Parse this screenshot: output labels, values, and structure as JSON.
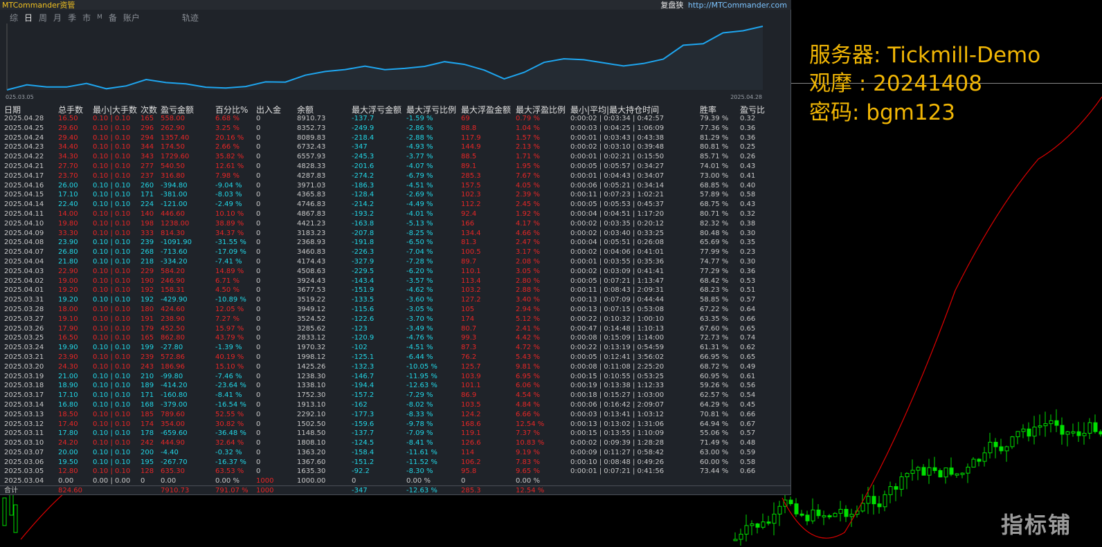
{
  "window": {
    "title": "MTCommander资管",
    "replay_label": "复盘狭",
    "site": "http://MTCommander.com"
  },
  "tabs": [
    "综",
    "日",
    "周",
    "月",
    "季",
    "市",
    "M",
    "备",
    "账户",
    "轨迹"
  ],
  "active_tab": "日",
  "equity": {
    "start_date": "025.03.05",
    "end_date": "2025.04.28",
    "line_color": "#1ea6f0"
  },
  "columns": [
    "日期",
    "总手数",
    "最小|大手数",
    "次数",
    "盈亏金额",
    "百分比%",
    "出入金",
    "余额",
    "最大浮亏金额",
    "最大浮亏比例",
    "最大浮盈金额",
    "最大浮盈比例",
    "最小|平均|最大持仓时间",
    "胜率",
    "盈亏比"
  ],
  "rows": [
    {
      "d": "2025.04.28",
      "lots": "16.50",
      "mm": "0.10 | 0.10",
      "n": "165",
      "pl": "558.00",
      "pct": "6.68 %",
      "io": "0",
      "bal": "8910.73",
      "mfl": "-137.7",
      "mflp": "-1.59 %",
      "mfp": "69",
      "mfpp": "0.79 %",
      "hold": "0:00:02 | 0:03:34 | 0:42:57",
      "win": "79.39 %",
      "ratio": "0.32",
      "s": "red"
    },
    {
      "d": "2025.04.25",
      "lots": "29.60",
      "mm": "0.10 | 0.10",
      "n": "296",
      "pl": "262.90",
      "pct": "3.25 %",
      "io": "0",
      "bal": "8352.73",
      "mfl": "-249.9",
      "mflp": "-2.86 %",
      "mfp": "88.8",
      "mfpp": "1.04 %",
      "hold": "0:00:03 | 0:04:25 | 1:06:09",
      "win": "77.36 %",
      "ratio": "0.36",
      "s": "red"
    },
    {
      "d": "2025.04.24",
      "lots": "29.40",
      "mm": "0.10 | 0.10",
      "n": "294",
      "pl": "1357.40",
      "pct": "20.16 %",
      "io": "0",
      "bal": "8089.83",
      "mfl": "-218.4",
      "mflp": "-2.88 %",
      "mfp": "117.9",
      "mfpp": "1.57 %",
      "hold": "0:00:01 | 0:03:43 | 0:43:38",
      "win": "81.29 %",
      "ratio": "0.36",
      "s": "red"
    },
    {
      "d": "2025.04.23",
      "lots": "34.40",
      "mm": "0.10 | 0.10",
      "n": "344",
      "pl": "174.50",
      "pct": "2.66 %",
      "io": "0",
      "bal": "6732.43",
      "mfl": "-347",
      "mflp": "-4.93 %",
      "mfp": "144.9",
      "mfpp": "2.13 %",
      "hold": "0:00:02 | 0:03:10 | 0:39:48",
      "win": "80.81 %",
      "ratio": "0.25",
      "s": "red"
    },
    {
      "d": "2025.04.22",
      "lots": "34.30",
      "mm": "0.10 | 0.10",
      "n": "343",
      "pl": "1729.60",
      "pct": "35.82 %",
      "io": "0",
      "bal": "6557.93",
      "mfl": "-245.3",
      "mflp": "-3.77 %",
      "mfp": "88.5",
      "mfpp": "1.71 %",
      "hold": "0:00:01 | 0:02:21 | 0:15:50",
      "win": "85.71 %",
      "ratio": "0.26",
      "s": "red"
    },
    {
      "d": "2025.04.21",
      "lots": "27.70",
      "mm": "0.10 | 0.10",
      "n": "277",
      "pl": "540.50",
      "pct": "12.61 %",
      "io": "0",
      "bal": "4828.33",
      "mfl": "-201.6",
      "mflp": "-4.07 %",
      "mfp": "89.1",
      "mfpp": "1.95 %",
      "hold": "0:00:05 | 0:05:57 | 0:34:27",
      "win": "74.01 %",
      "ratio": "0.43",
      "s": "red"
    },
    {
      "d": "2025.04.17",
      "lots": "23.70",
      "mm": "0.10 | 0.10",
      "n": "237",
      "pl": "316.80",
      "pct": "7.98 %",
      "io": "0",
      "bal": "4287.83",
      "mfl": "-274.2",
      "mflp": "-6.79 %",
      "mfp": "285.3",
      "mfpp": "7.67 %",
      "hold": "0:00:01 | 0:04:43 | 0:34:07",
      "win": "73.00 %",
      "ratio": "0.41",
      "s": "red"
    },
    {
      "d": "2025.04.16",
      "lots": "26.00",
      "mm": "0.10 | 0.10",
      "n": "260",
      "pl": "-394.80",
      "pct": "-9.04 %",
      "io": "0",
      "bal": "3971.03",
      "mfl": "-186.3",
      "mflp": "-4.51 %",
      "mfp": "157.5",
      "mfpp": "4.05 %",
      "hold": "0:00:06 | 0:05:21 | 0:34:14",
      "win": "68.85 %",
      "ratio": "0.40",
      "s": "cyan"
    },
    {
      "d": "2025.04.15",
      "lots": "17.10",
      "mm": "0.10 | 0.10",
      "n": "171",
      "pl": "-381.00",
      "pct": "-8.03 %",
      "io": "0",
      "bal": "4365.83",
      "mfl": "-128.4",
      "mflp": "-2.69 %",
      "mfp": "102.3",
      "mfpp": "2.39 %",
      "hold": "0:00:11 | 0:07:23 | 1:02:21",
      "win": "57.89 %",
      "ratio": "0.58",
      "s": "cyan"
    },
    {
      "d": "2025.04.14",
      "lots": "22.40",
      "mm": "0.10 | 0.10",
      "n": "224",
      "pl": "-121.00",
      "pct": "-2.49 %",
      "io": "0",
      "bal": "4746.83",
      "mfl": "-214.2",
      "mflp": "-4.49 %",
      "mfp": "112.2",
      "mfpp": "2.45 %",
      "hold": "0:00:05 | 0:05:53 | 0:45:37",
      "win": "68.75 %",
      "ratio": "0.43",
      "s": "cyan"
    },
    {
      "d": "2025.04.11",
      "lots": "14.00",
      "mm": "0.10 | 0.10",
      "n": "140",
      "pl": "446.60",
      "pct": "10.10 %",
      "io": "0",
      "bal": "4867.83",
      "mfl": "-193.2",
      "mflp": "-4.01 %",
      "mfp": "92.4",
      "mfpp": "1.92 %",
      "hold": "0:00:04 | 0:04:51 | 1:17:20",
      "win": "80.71 %",
      "ratio": "0.32",
      "s": "red"
    },
    {
      "d": "2025.04.10",
      "lots": "19.80",
      "mm": "0.10 | 0.10",
      "n": "198",
      "pl": "1238.00",
      "pct": "38.89 %",
      "io": "0",
      "bal": "4421.23",
      "mfl": "-163.8",
      "mflp": "-5.13 %",
      "mfp": "166",
      "mfpp": "4.17 %",
      "hold": "0:00:02 | 0:03:35 | 0:20:12",
      "win": "82.32 %",
      "ratio": "0.38",
      "s": "red"
    },
    {
      "d": "2025.04.09",
      "lots": "33.30",
      "mm": "0.10 | 0.10",
      "n": "333",
      "pl": "814.30",
      "pct": "34.37 %",
      "io": "0",
      "bal": "3183.23",
      "mfl": "-207.8",
      "mflp": "-8.25 %",
      "mfp": "134.4",
      "mfpp": "4.66 %",
      "hold": "0:00:02 | 0:03:40 | 0:33:25",
      "win": "80.48 %",
      "ratio": "0.30",
      "s": "red"
    },
    {
      "d": "2025.04.08",
      "lots": "23.90",
      "mm": "0.10 | 0.10",
      "n": "239",
      "pl": "-1091.90",
      "pct": "-31.55 %",
      "io": "0",
      "bal": "2368.93",
      "mfl": "-191.8",
      "mflp": "-6.50 %",
      "mfp": "81.3",
      "mfpp": "2.47 %",
      "hold": "0:00:04 | 0:05:51 | 0:26:08",
      "win": "65.69 %",
      "ratio": "0.35",
      "s": "cyan"
    },
    {
      "d": "2025.04.07",
      "lots": "26.80",
      "mm": "0.10 | 0.10",
      "n": "268",
      "pl": "-713.60",
      "pct": "-17.09 %",
      "io": "0",
      "bal": "3460.83",
      "mfl": "-226.3",
      "mflp": "-7.04 %",
      "mfp": "100.5",
      "mfpp": "3.17 %",
      "hold": "0:00:02 | 0:04:06 | 0:41:01",
      "win": "77.99 %",
      "ratio": "0.23",
      "s": "cyan"
    },
    {
      "d": "2025.04.04",
      "lots": "21.80",
      "mm": "0.10 | 0.10",
      "n": "218",
      "pl": "-334.20",
      "pct": "-7.41 %",
      "io": "0",
      "bal": "4174.43",
      "mfl": "-327.9",
      "mflp": "-7.28 %",
      "mfp": "89.7",
      "mfpp": "2.08 %",
      "hold": "0:00:01 | 0:03:55 | 0:35:36",
      "win": "74.77 %",
      "ratio": "0.30",
      "s": "cyan"
    },
    {
      "d": "2025.04.03",
      "lots": "22.90",
      "mm": "0.10 | 0.10",
      "n": "229",
      "pl": "584.20",
      "pct": "14.89 %",
      "io": "0",
      "bal": "4508.63",
      "mfl": "-229.5",
      "mflp": "-6.20 %",
      "mfp": "110.1",
      "mfpp": "3.05 %",
      "hold": "0:00:02 | 0:03:09 | 0:41:41",
      "win": "77.29 %",
      "ratio": "0.36",
      "s": "red"
    },
    {
      "d": "2025.04.02",
      "lots": "19.00",
      "mm": "0.10 | 0.10",
      "n": "190",
      "pl": "246.90",
      "pct": "6.71 %",
      "io": "0",
      "bal": "3924.43",
      "mfl": "-143.4",
      "mflp": "-3.57 %",
      "mfp": "113.4",
      "mfpp": "2.80 %",
      "hold": "0:00:05 | 0:07:21 | 1:13:47",
      "win": "68.42 %",
      "ratio": "0.53",
      "s": "red"
    },
    {
      "d": "2025.04.01",
      "lots": "19.20",
      "mm": "0.10 | 0.10",
      "n": "192",
      "pl": "158.31",
      "pct": "4.50 %",
      "io": "0",
      "bal": "3677.53",
      "mfl": "-151.9",
      "mflp": "-4.62 %",
      "mfp": "103.2",
      "mfpp": "2.88 %",
      "hold": "0:00:11 | 0:08:43 | 2:09:31",
      "win": "68.23 %",
      "ratio": "0.51",
      "s": "red"
    },
    {
      "d": "2025.03.31",
      "lots": "19.20",
      "mm": "0.10 | 0.10",
      "n": "192",
      "pl": "-429.90",
      "pct": "-10.89 %",
      "io": "0",
      "bal": "3519.22",
      "mfl": "-133.5",
      "mflp": "-3.60 %",
      "mfp": "127.2",
      "mfpp": "3.40 %",
      "hold": "0:00:13 | 0:07:09 | 0:44:44",
      "win": "58.85 %",
      "ratio": "0.57",
      "s": "cyan"
    },
    {
      "d": "2025.03.28",
      "lots": "18.00",
      "mm": "0.10 | 0.10",
      "n": "180",
      "pl": "424.60",
      "pct": "12.05 %",
      "io": "0",
      "bal": "3949.12",
      "mfl": "-115.6",
      "mflp": "-3.05 %",
      "mfp": "105",
      "mfpp": "2.94 %",
      "hold": "0:00:13 | 0:07:15 | 0:53:08",
      "win": "67.22 %",
      "ratio": "0.64",
      "s": "red"
    },
    {
      "d": "2025.03.27",
      "lots": "19.10",
      "mm": "0.10 | 0.10",
      "n": "191",
      "pl": "238.90",
      "pct": "7.27 %",
      "io": "0",
      "bal": "3524.52",
      "mfl": "-122.6",
      "mflp": "-3.70 %",
      "mfp": "174",
      "mfpp": "5.12 %",
      "hold": "0:00:22 | 0:10:32 | 1:00:10",
      "win": "63.35 %",
      "ratio": "0.66",
      "s": "red"
    },
    {
      "d": "2025.03.26",
      "lots": "17.90",
      "mm": "0.10 | 0.10",
      "n": "179",
      "pl": "452.50",
      "pct": "15.97 %",
      "io": "0",
      "bal": "3285.62",
      "mfl": "-123",
      "mflp": "-3.49 %",
      "mfp": "80.7",
      "mfpp": "2.41 %",
      "hold": "0:00:47 | 0:14:48 | 1:10:13",
      "win": "67.60 %",
      "ratio": "0.65",
      "s": "red"
    },
    {
      "d": "2025.03.25",
      "lots": "16.50",
      "mm": "0.10 | 0.10",
      "n": "165",
      "pl": "862.80",
      "pct": "43.79 %",
      "io": "0",
      "bal": "2833.12",
      "mfl": "-120.9",
      "mflp": "-4.76 %",
      "mfp": "99.3",
      "mfpp": "4.42 %",
      "hold": "0:00:08 | 0:15:09 | 1:14:00",
      "win": "72.73 %",
      "ratio": "0.74",
      "s": "red"
    },
    {
      "d": "2025.03.24",
      "lots": "19.90",
      "mm": "0.10 | 0.10",
      "n": "199",
      "pl": "-27.80",
      "pct": "-1.39 %",
      "io": "0",
      "bal": "1970.32",
      "mfl": "-102",
      "mflp": "-4.51 %",
      "mfp": "87.3",
      "mfpp": "4.72 %",
      "hold": "0:00:22 | 0:13:19 | 0:54:59",
      "win": "61.31 %",
      "ratio": "0.62",
      "s": "cyan"
    },
    {
      "d": "2025.03.21",
      "lots": "23.90",
      "mm": "0.10 | 0.10",
      "n": "239",
      "pl": "572.86",
      "pct": "40.19 %",
      "io": "0",
      "bal": "1998.12",
      "mfl": "-125.1",
      "mflp": "-6.44 %",
      "mfp": "76.2",
      "mfpp": "5.43 %",
      "hold": "0:00:05 | 0:12:41 | 3:56:02",
      "win": "66.95 %",
      "ratio": "0.65",
      "s": "red"
    },
    {
      "d": "2025.03.20",
      "lots": "24.30",
      "mm": "0.10 | 0.10",
      "n": "243",
      "pl": "186.96",
      "pct": "15.10 %",
      "io": "0",
      "bal": "1425.26",
      "mfl": "-132.3",
      "mflp": "-10.05 %",
      "mfp": "125.7",
      "mfpp": "9.81 %",
      "hold": "0:00:08 | 0:11:08 | 2:25:20",
      "win": "68.72 %",
      "ratio": "0.49",
      "s": "red"
    },
    {
      "d": "2025.03.19",
      "lots": "21.00",
      "mm": "0.10 | 0.10",
      "n": "210",
      "pl": "-99.80",
      "pct": "-7.46 %",
      "io": "0",
      "bal": "1238.30",
      "mfl": "-146.7",
      "mflp": "-11.95 %",
      "mfp": "103.9",
      "mfpp": "6.95 %",
      "hold": "0:00:15 | 0:10:55 | 0:53:25",
      "win": "60.95 %",
      "ratio": "0.61",
      "s": "cyan"
    },
    {
      "d": "2025.03.18",
      "lots": "18.90",
      "mm": "0.10 | 0.10",
      "n": "189",
      "pl": "-414.20",
      "pct": "-23.64 %",
      "io": "0",
      "bal": "1338.10",
      "mfl": "-194.4",
      "mflp": "-12.63 %",
      "mfp": "101.1",
      "mfpp": "6.06 %",
      "hold": "0:00:19 | 0:13:38 | 1:12:33",
      "win": "59.26 %",
      "ratio": "0.56",
      "s": "cyan"
    },
    {
      "d": "2025.03.17",
      "lots": "17.10",
      "mm": "0.10 | 0.10",
      "n": "171",
      "pl": "-160.80",
      "pct": "-8.41 %",
      "io": "0",
      "bal": "1752.30",
      "mfl": "-157.2",
      "mflp": "-7.29 %",
      "mfp": "86.9",
      "mfpp": "4.54 %",
      "hold": "0:00:18 | 0:15:27 | 1:03:00",
      "win": "62.57 %",
      "ratio": "0.54",
      "s": "cyan"
    },
    {
      "d": "2025.03.14",
      "lots": "16.80",
      "mm": "0.10 | 0.10",
      "n": "168",
      "pl": "-379.00",
      "pct": "-16.54 %",
      "io": "0",
      "bal": "1913.10",
      "mfl": "-162",
      "mflp": "-8.02 %",
      "mfp": "103.5",
      "mfpp": "4.84 %",
      "hold": "0:00:06 | 0:16:42 | 2:09:07",
      "win": "64.29 %",
      "ratio": "0.45",
      "s": "cyan"
    },
    {
      "d": "2025.03.13",
      "lots": "18.50",
      "mm": "0.10 | 0.10",
      "n": "185",
      "pl": "789.60",
      "pct": "52.55 %",
      "io": "0",
      "bal": "2292.10",
      "mfl": "-177.3",
      "mflp": "-8.33 %",
      "mfp": "124.2",
      "mfpp": "6.66 %",
      "hold": "0:00:03 | 0:13:41 | 1:03:12",
      "win": "70.81 %",
      "ratio": "0.66",
      "s": "red"
    },
    {
      "d": "2025.03.12",
      "lots": "17.40",
      "mm": "0.10 | 0.10",
      "n": "174",
      "pl": "354.00",
      "pct": "30.82 %",
      "io": "0",
      "bal": "1502.50",
      "mfl": "-159.6",
      "mflp": "-9.78 %",
      "mfp": "168.6",
      "mfpp": "12.54 %",
      "hold": "0:00:13 | 0:13:02 | 1:31:06",
      "win": "64.94 %",
      "ratio": "0.67",
      "s": "red"
    },
    {
      "d": "2025.03.11",
      "lots": "17.80",
      "mm": "0.10 | 0.10",
      "n": "178",
      "pl": "-659.60",
      "pct": "-36.48 %",
      "io": "0",
      "bal": "1148.50",
      "mfl": "-137.7",
      "mflp": "-7.09 %",
      "mfp": "119.1",
      "mfpp": "7.37 %",
      "hold": "0:00:15 | 0:13:55 | 1:10:09",
      "win": "55.06 %",
      "ratio": "0.57",
      "s": "cyan"
    },
    {
      "d": "2025.03.10",
      "lots": "24.20",
      "mm": "0.10 | 0.10",
      "n": "242",
      "pl": "444.90",
      "pct": "32.64 %",
      "io": "0",
      "bal": "1808.10",
      "mfl": "-124.5",
      "mflp": "-8.41 %",
      "mfp": "126.6",
      "mfpp": "10.83 %",
      "hold": "0:00:02 | 0:09:39 | 1:28:28",
      "win": "71.49 %",
      "ratio": "0.48",
      "s": "red"
    },
    {
      "d": "2025.03.07",
      "lots": "20.00",
      "mm": "0.10 | 0.10",
      "n": "200",
      "pl": "-4.40",
      "pct": "-0.32 %",
      "io": "0",
      "bal": "1363.20",
      "mfl": "-158.4",
      "mflp": "-11.61 %",
      "mfp": "114",
      "mfpp": "9.19 %",
      "hold": "0:00:09 | 0:11:27 | 0:58:42",
      "win": "63.00 %",
      "ratio": "0.59",
      "s": "cyan"
    },
    {
      "d": "2025.03.06",
      "lots": "19.50",
      "mm": "0.10 | 0.10",
      "n": "195",
      "pl": "-267.70",
      "pct": "-16.37 %",
      "io": "0",
      "bal": "1367.60",
      "mfl": "-151.2",
      "mflp": "-11.52 %",
      "mfp": "106.2",
      "mfpp": "7.83 %",
      "hold": "0:00:10 | 0:08:48 | 0:49:26",
      "win": "60.00 %",
      "ratio": "0.58",
      "s": "cyan"
    },
    {
      "d": "2025.03.05",
      "lots": "12.80",
      "mm": "0.10 | 0.10",
      "n": "128",
      "pl": "635.30",
      "pct": "63.53 %",
      "io": "0",
      "bal": "1635.30",
      "mfl": "-92.2",
      "mflp": "-8.30 %",
      "mfp": "95.8",
      "mfpp": "9.65 %",
      "hold": "0:00:01 | 0:07:21 | 0:41:56",
      "win": "73.44 %",
      "ratio": "0.66",
      "s": "red"
    },
    {
      "d": "2025.03.04",
      "lots": "0.00",
      "mm": "0.00 | 0.00",
      "n": "0",
      "pl": "0.00",
      "pct": "0.00 %",
      "io": "1000",
      "bal": "1000.00",
      "mfl": "0",
      "mflp": "0.00 %",
      "mfp": "0",
      "mfpp": "0.00 %",
      "hold": "",
      "win": "",
      "ratio": "",
      "s": "white"
    }
  ],
  "totals": {
    "label": "合计",
    "lots": "824.60",
    "pl": "7910.73",
    "pct": "791.07 %",
    "io": "1000",
    "mfl": "-347",
    "mflp": "-12.63 %",
    "mfp": "285.3",
    "mfpp": "12.54 %"
  },
  "overlay": {
    "server": "服务器: Tickmill-Demo",
    "watch": "观摩 : 20241408",
    "password": "密码: bgm123",
    "watermark": "指标铺"
  },
  "colors": {
    "profit": "#e82626",
    "loss": "#22d8e8",
    "overlay_text": "#f2b705",
    "bull_candle": "#00e000",
    "ma_line": "#e00000"
  }
}
